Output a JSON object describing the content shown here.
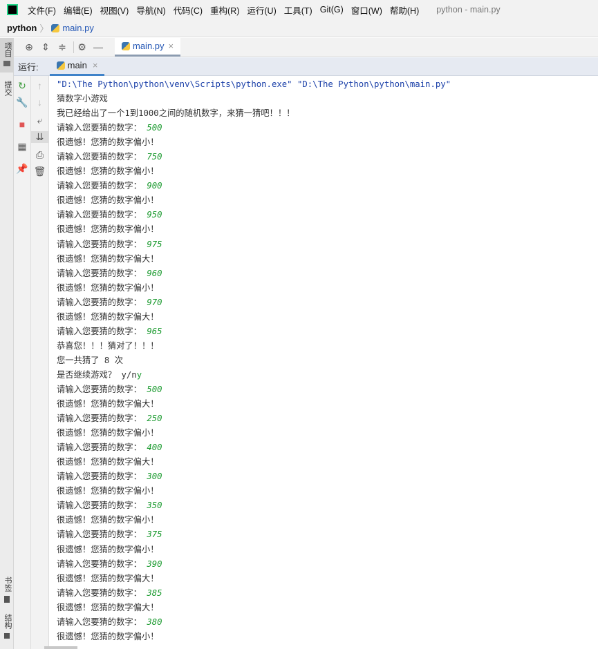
{
  "menubar": {
    "logo": "PC",
    "items": [
      "文件(F)",
      "编辑(E)",
      "视图(V)",
      "导航(N)",
      "代码(C)",
      "重构(R)",
      "运行(U)",
      "工具(T)",
      "Git(G)",
      "窗口(W)",
      "帮助(H)"
    ],
    "title": "python - main.py"
  },
  "navbar": {
    "project": "python",
    "file": "main.py"
  },
  "side": {
    "project": "项目",
    "commit": "提交",
    "bookmarks": "书签",
    "structure": "结构"
  },
  "editor_tab": {
    "label": "main.py"
  },
  "run": {
    "label": "运行:",
    "tab": "main"
  },
  "console": [
    {
      "t": "cmd",
      "text": "\"D:\\The Python\\python\\venv\\Scripts\\python.exe\" \"D:\\The Python\\python\\main.py\""
    },
    {
      "t": "out",
      "text": "猜数字小游戏"
    },
    {
      "t": "out",
      "text": "我已经给出了一个1到1000之间的随机数字，来猜一猜吧！！！"
    },
    {
      "t": "in",
      "text": "请输入您要猜的数字： ",
      "input": "500"
    },
    {
      "t": "out",
      "text": "很遗憾！您猜的数字偏小！"
    },
    {
      "t": "in",
      "text": "请输入您要猜的数字： ",
      "input": "750"
    },
    {
      "t": "out",
      "text": "很遗憾！您猜的数字偏小！"
    },
    {
      "t": "in",
      "text": "请输入您要猜的数字： ",
      "input": "900"
    },
    {
      "t": "out",
      "text": "很遗憾！您猜的数字偏小！"
    },
    {
      "t": "in",
      "text": "请输入您要猜的数字： ",
      "input": "950"
    },
    {
      "t": "out",
      "text": "很遗憾！您猜的数字偏小！"
    },
    {
      "t": "in",
      "text": "请输入您要猜的数字： ",
      "input": "975"
    },
    {
      "t": "out",
      "text": "很遗憾！您猜的数字偏大！"
    },
    {
      "t": "in",
      "text": "请输入您要猜的数字： ",
      "input": "960"
    },
    {
      "t": "out",
      "text": "很遗憾！您猜的数字偏小！"
    },
    {
      "t": "in",
      "text": "请输入您要猜的数字： ",
      "input": "970"
    },
    {
      "t": "out",
      "text": "很遗憾！您猜的数字偏大！"
    },
    {
      "t": "in",
      "text": "请输入您要猜的数字： ",
      "input": "965"
    },
    {
      "t": "out",
      "text": "恭喜您！！！猜对了！！！"
    },
    {
      "t": "out",
      "text": "您一共猜了 8 次"
    },
    {
      "t": "yn",
      "text": "是否继续游戏？ y/n",
      "input": "y"
    },
    {
      "t": "in",
      "text": "请输入您要猜的数字： ",
      "input": "500"
    },
    {
      "t": "out",
      "text": "很遗憾！您猜的数字偏大！"
    },
    {
      "t": "in",
      "text": "请输入您要猜的数字： ",
      "input": "250"
    },
    {
      "t": "out",
      "text": "很遗憾！您猜的数字偏小！"
    },
    {
      "t": "in",
      "text": "请输入您要猜的数字： ",
      "input": "400"
    },
    {
      "t": "out",
      "text": "很遗憾！您猜的数字偏大！"
    },
    {
      "t": "in",
      "text": "请输入您要猜的数字： ",
      "input": "300"
    },
    {
      "t": "out",
      "text": "很遗憾！您猜的数字偏小！"
    },
    {
      "t": "in",
      "text": "请输入您要猜的数字： ",
      "input": "350"
    },
    {
      "t": "out",
      "text": "很遗憾！您猜的数字偏小！"
    },
    {
      "t": "in",
      "text": "请输入您要猜的数字： ",
      "input": "375"
    },
    {
      "t": "out",
      "text": "很遗憾！您猜的数字偏小！"
    },
    {
      "t": "in",
      "text": "请输入您要猜的数字： ",
      "input": "390"
    },
    {
      "t": "out",
      "text": "很遗憾！您猜的数字偏大！"
    },
    {
      "t": "in",
      "text": "请输入您要猜的数字： ",
      "input": "385"
    },
    {
      "t": "out",
      "text": "很遗憾！您猜的数字偏大！"
    },
    {
      "t": "in",
      "text": "请输入您要猜的数字： ",
      "input": "380"
    },
    {
      "t": "out",
      "text": "很遗憾！您猜的数字偏小！"
    }
  ]
}
